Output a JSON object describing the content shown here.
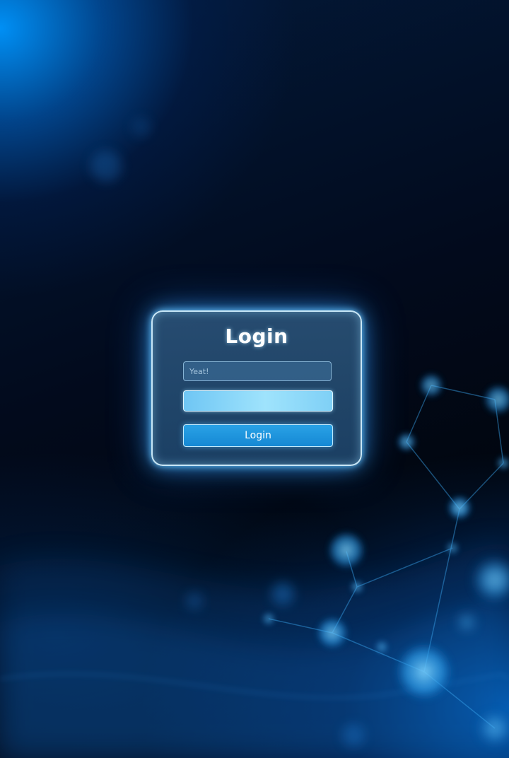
{
  "login_form": {
    "title": "Login",
    "email_placeholder": "Yeat!",
    "password_value": "",
    "submit_label": "Login"
  },
  "colors": {
    "background_dark": "#020814",
    "background_glow": "#0096ff",
    "card_border": "#d2f0ff",
    "password_field_fill": "#9fe3fc",
    "button_fill": "#1e96dc"
  }
}
